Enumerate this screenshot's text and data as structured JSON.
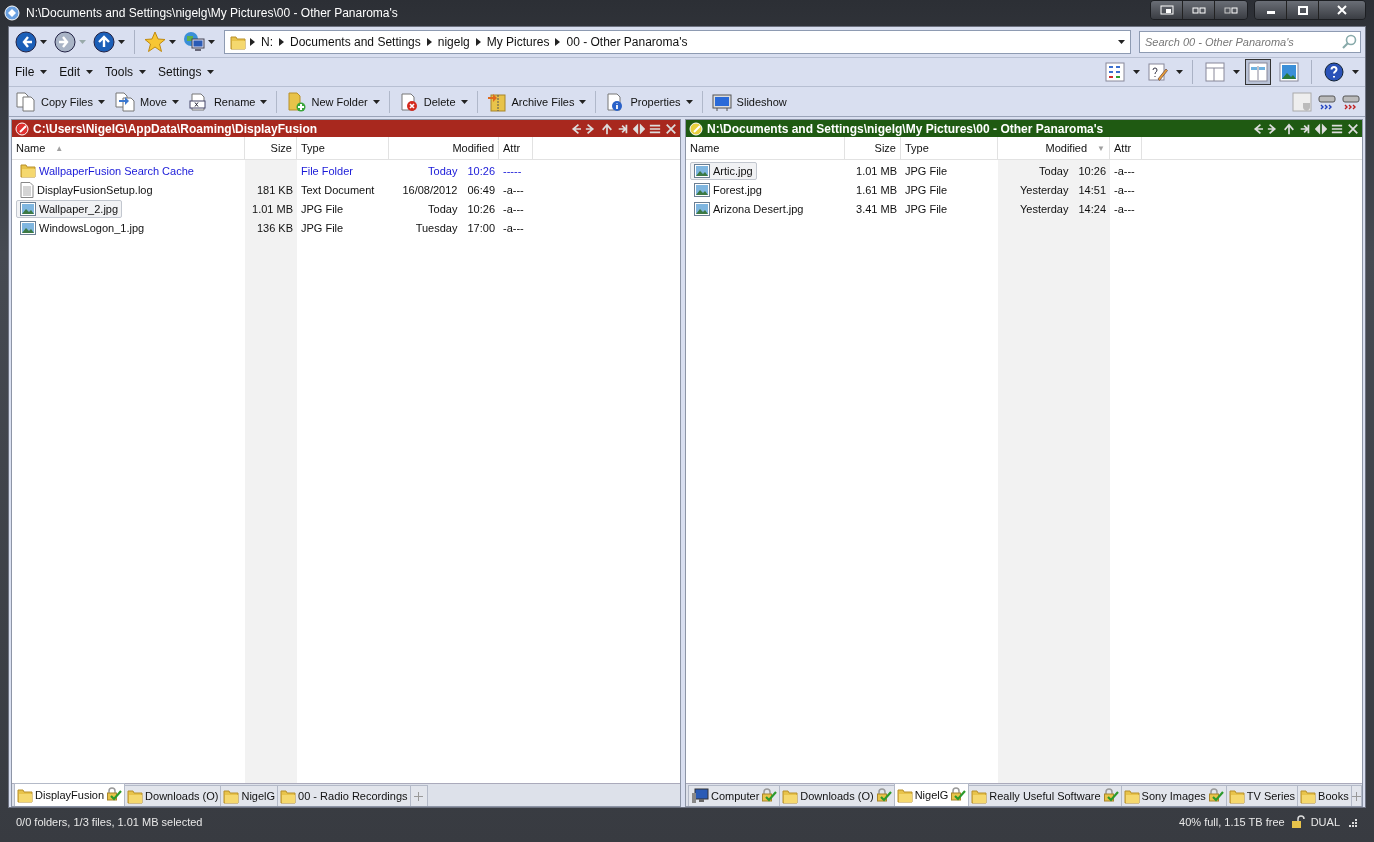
{
  "window": {
    "title": "N:\\Documents and Settings\\nigelg\\My Pictures\\00 - Other Panaroma's"
  },
  "nav": [
    {
      "kind": "back",
      "disabled": false
    },
    {
      "kind": "forward",
      "disabled": true
    },
    {
      "kind": "up",
      "disabled": false
    },
    {
      "kind": "favorites",
      "disabled": false
    },
    {
      "kind": "network",
      "disabled": false
    }
  ],
  "address": {
    "crumbs": [
      "N:",
      "Documents and Settings",
      "nigelg",
      "My Pictures",
      "00 - Other Panaroma's"
    ]
  },
  "search": {
    "placeholder": "Search 00 - Other Panaroma's"
  },
  "menu": [
    "File",
    "Edit",
    "Tools",
    "Settings"
  ],
  "view_buttons": [
    {
      "kind": "grid",
      "selected": false
    },
    {
      "kind": "notes",
      "selected": false
    },
    {
      "kind": "panel",
      "selected": false
    },
    {
      "kind": "dual",
      "selected": true
    },
    {
      "kind": "image",
      "selected": false
    },
    {
      "kind": "help",
      "selected": false
    }
  ],
  "toolbar": [
    {
      "label": "Copy Files",
      "kind": "copy",
      "dropdown": true
    },
    {
      "label": "Move",
      "kind": "move",
      "dropdown": true
    },
    {
      "label": "Rename",
      "kind": "rename",
      "dropdown": true
    },
    {
      "label": "New Folder",
      "kind": "newfolder",
      "dropdown": true
    },
    {
      "label": "Delete",
      "kind": "delete",
      "dropdown": true
    },
    {
      "label": "Archive Files",
      "kind": "archive",
      "dropdown": true
    },
    {
      "label": "Properties",
      "kind": "properties",
      "dropdown": true
    },
    {
      "label": "Slideshow",
      "kind": "slideshow",
      "dropdown": false
    }
  ],
  "panes": [
    {
      "path": "C:\\Users\\NigelG\\AppData\\Roaming\\DisplayFusion",
      "color": "#a8281e",
      "columns": [
        {
          "label": "Name",
          "sort_arrow": "▲",
          "shaded": false
        },
        {
          "label": "Size",
          "shaded": true
        },
        {
          "label": "Type",
          "shaded": false
        },
        {
          "label": "Modified",
          "shaded": false
        },
        {
          "label": "Attr",
          "shaded": false
        }
      ],
      "rows": [
        {
          "name": "WallpaperFusion Search Cache",
          "size": "",
          "type": "File Folder",
          "date": "Today",
          "time": "10:26",
          "attr": "-----",
          "kind": "folder",
          "selected": false
        },
        {
          "name": "DisplayFusionSetup.log",
          "size": "181 KB",
          "type": "Text Document",
          "date": "16/08/2012",
          "time": "06:49",
          "attr": "-a---",
          "kind": "text",
          "selected": false
        },
        {
          "name": "Wallpaper_2.jpg",
          "size": "1.01 MB",
          "type": "JPG File",
          "date": "Today",
          "time": "10:26",
          "attr": "-a---",
          "kind": "image",
          "selected": true
        },
        {
          "name": "WindowsLogon_1.jpg",
          "size": "136 KB",
          "type": "JPG File",
          "date": "Tuesday",
          "time": "17:00",
          "attr": "-a---",
          "kind": "image",
          "selected": false
        }
      ],
      "tabs": [
        {
          "label": "DisplayFusion",
          "kind": "folder",
          "locked": true,
          "selected": true
        },
        {
          "label": "Downloads (O)",
          "kind": "folder",
          "locked": false,
          "selected": false
        },
        {
          "label": "NigelG",
          "kind": "folder",
          "locked": false,
          "selected": false
        },
        {
          "label": "00 - Radio Recordings",
          "kind": "folder",
          "locked": false,
          "selected": false
        }
      ]
    },
    {
      "path": "N:\\Documents and Settings\\nigelg\\My Pictures\\00 - Other Panaroma's",
      "color": "#1f5a12",
      "columns": [
        {
          "label": "Name",
          "shaded": false
        },
        {
          "label": "Size",
          "shaded": false
        },
        {
          "label": "Type",
          "shaded": false
        },
        {
          "label": "Modified",
          "sort_arrow": "▼",
          "shaded": true
        },
        {
          "label": "Attr",
          "shaded": false
        }
      ],
      "rows": [
        {
          "name": "Artic.jpg",
          "size": "1.01 MB",
          "type": "JPG File",
          "date": "Today",
          "time": "10:26",
          "attr": "-a---",
          "kind": "image",
          "selected": true
        },
        {
          "name": "Forest.jpg",
          "size": "1.61 MB",
          "type": "JPG File",
          "date": "Yesterday",
          "time": "14:51",
          "attr": "-a---",
          "kind": "image",
          "selected": false
        },
        {
          "name": "Arizona Desert.jpg",
          "size": "3.41 MB",
          "type": "JPG File",
          "date": "Yesterday",
          "time": "14:24",
          "attr": "-a---",
          "kind": "image",
          "selected": false
        }
      ],
      "tabs": [
        {
          "label": "Computer",
          "kind": "computer",
          "locked": true,
          "selected": false
        },
        {
          "label": "Downloads (O)",
          "kind": "folder",
          "locked": true,
          "selected": false
        },
        {
          "label": "NigelG",
          "kind": "folder",
          "locked": true,
          "selected": true
        },
        {
          "label": "Really Useful Software",
          "kind": "folder",
          "locked": true,
          "selected": false
        },
        {
          "label": "Sony Images",
          "kind": "folder",
          "locked": true,
          "selected": false
        },
        {
          "label": "TV Series",
          "kind": "folder",
          "locked": false,
          "selected": false
        },
        {
          "label": "Books",
          "kind": "folder",
          "locked": false,
          "selected": false
        }
      ]
    }
  ],
  "status": {
    "selection": "0/0 folders, 1/3 files, 1.01 MB selected",
    "space": "40% full, 1.15 TB free",
    "mode": "DUAL"
  }
}
